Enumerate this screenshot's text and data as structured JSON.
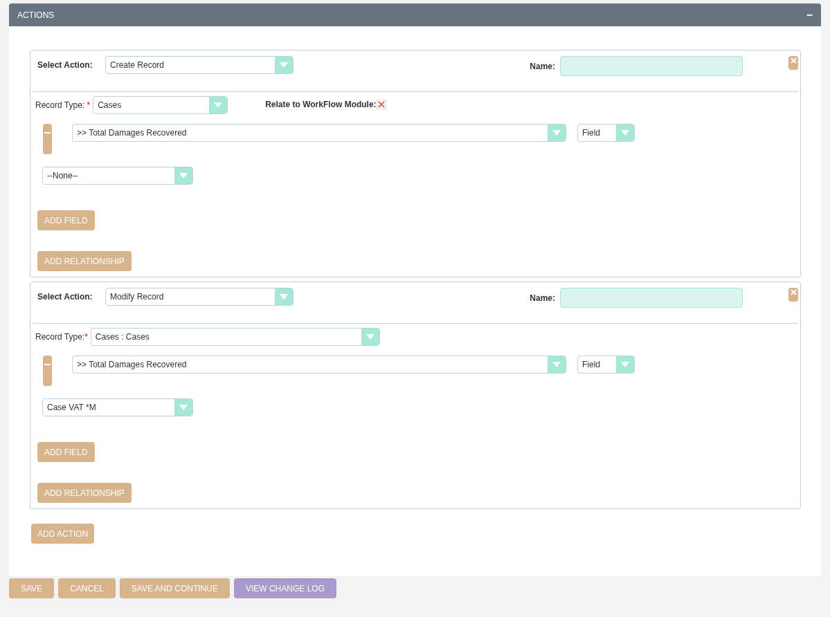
{
  "panel": {
    "title": "ACTIONS",
    "collapse_symbol": "−"
  },
  "actions": [
    {
      "select_action_label": "Select Action:",
      "action": "Create Record",
      "name_label": "Name:",
      "record_type_label": "Record Type:",
      "required_mark": " *",
      "record_type": "Cases",
      "relate": {
        "label": "Relate to WorkFlow Module:"
      },
      "field": ">> Total Damages Recovered",
      "field_type": "Field",
      "relationship": "--None--",
      "add_field": "ADD FIELD",
      "add_relationship": "ADD RELATIONSHIP"
    },
    {
      "select_action_label": "Select Action:",
      "action": "Modify Record",
      "name_label": "Name:",
      "record_type_label": "Record Type:",
      "required_mark": "*",
      "record_type": "Cases : Cases",
      "field": ">> Total Damages Recovered",
      "field_type": "Field",
      "relationship": "Case VAT *M",
      "add_field": "ADD FIELD",
      "add_relationship": "ADD RELATIONSHIP"
    }
  ],
  "add_action": "ADD ACTION",
  "footer_buttons": [
    {
      "label": "SAVE",
      "kind": "primary"
    },
    {
      "label": "CANCEL",
      "kind": "primary"
    },
    {
      "label": "SAVE AND CONTINUE",
      "kind": "primary"
    },
    {
      "label": "VIEW CHANGE LOG",
      "kind": "secondary"
    }
  ]
}
